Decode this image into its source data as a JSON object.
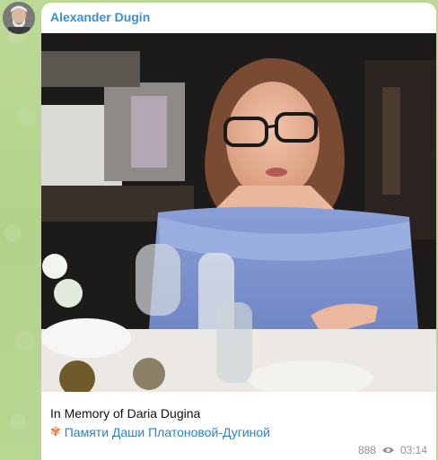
{
  "channel": {
    "name": "Alexander Dugin"
  },
  "message": {
    "caption_line1": "In Memory of Daria Dugina",
    "caption_line2_icon": "flower-icon",
    "caption_line2_link": "Памяти Даши Платоновой-Дугиной",
    "views": "888",
    "time": "03:14"
  },
  "colors": {
    "chat_background": "#b9d693",
    "sender_name": "#3a8fd6",
    "link": "#2b82d0",
    "meta": "#8a9298"
  }
}
